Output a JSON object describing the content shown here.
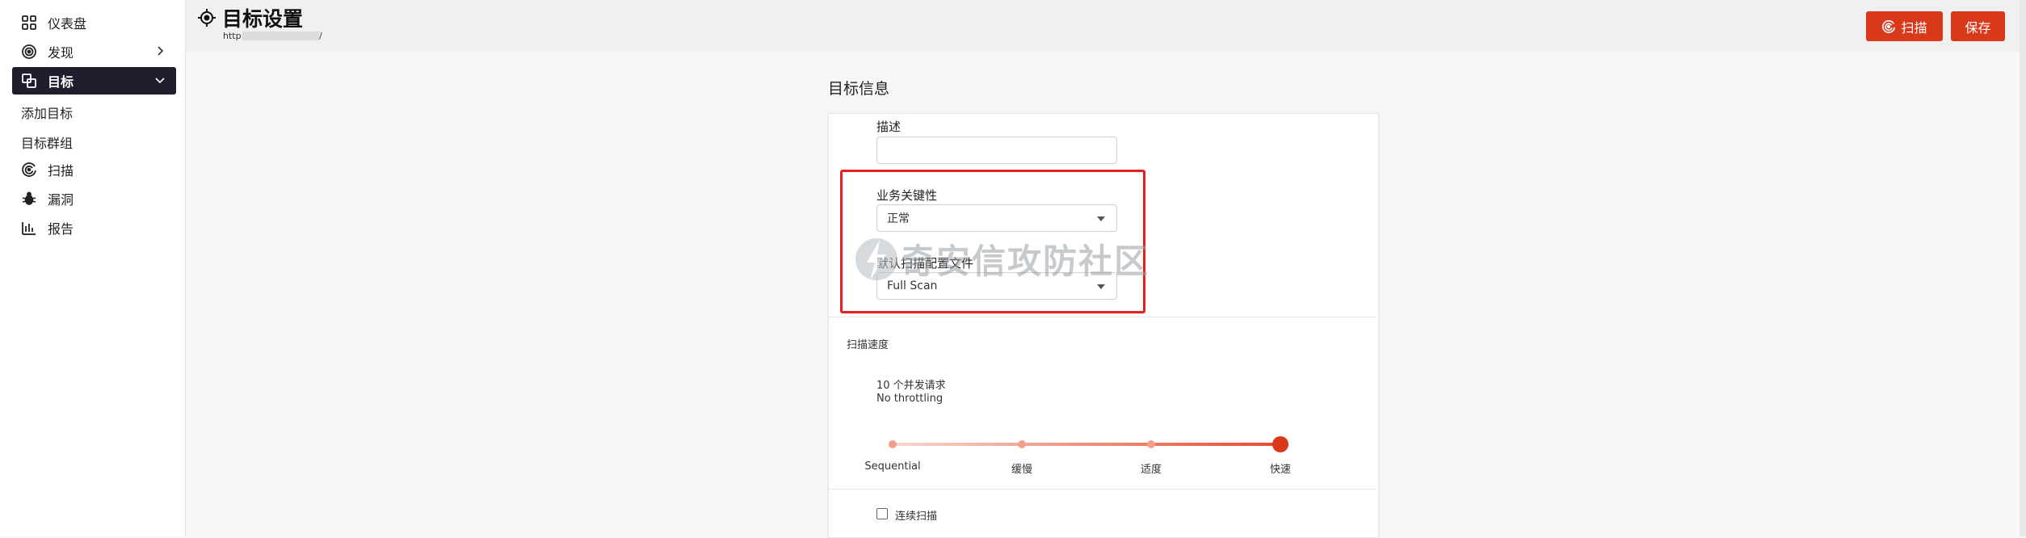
{
  "sidebar": {
    "items": [
      {
        "label": "仪表盘",
        "icon": "dashboard-grid-icon"
      },
      {
        "label": "发现",
        "icon": "discover-target-icon"
      },
      {
        "label": "目标",
        "icon": "target-copy-icon"
      },
      {
        "label": "扫描",
        "icon": "scan-radar-icon"
      },
      {
        "label": "漏洞",
        "icon": "bug-icon"
      },
      {
        "label": "报告",
        "icon": "report-chart-icon"
      }
    ],
    "sub_items": [
      "添加目标",
      "目标群组"
    ]
  },
  "header": {
    "title": "目标设置",
    "url_prefix": "http://",
    "url_suffix": "/",
    "scan_label": "扫描",
    "save_label": "保存"
  },
  "main": {
    "section_title": "目标信息",
    "description_label": "描述",
    "description_value": "",
    "criticality_label": "业务关键性",
    "criticality_value": "正常",
    "profile_label": "默认扫描配置文件",
    "profile_value": "Full Scan",
    "speed_label": "扫描速度",
    "speed_line1": "10 个并发请求",
    "speed_line2": "No throttling",
    "speed_ticks": [
      "Sequential",
      "缓慢",
      "适度",
      "快速"
    ],
    "speed_selected": "快速",
    "continuous_label": "连续扫描",
    "continuous_checked": false
  },
  "watermark": "奇安信攻防社区",
  "colors": {
    "accent": "#d9391b",
    "sidebar_active": "#1e1e2e",
    "highlight": "#e4211f"
  }
}
